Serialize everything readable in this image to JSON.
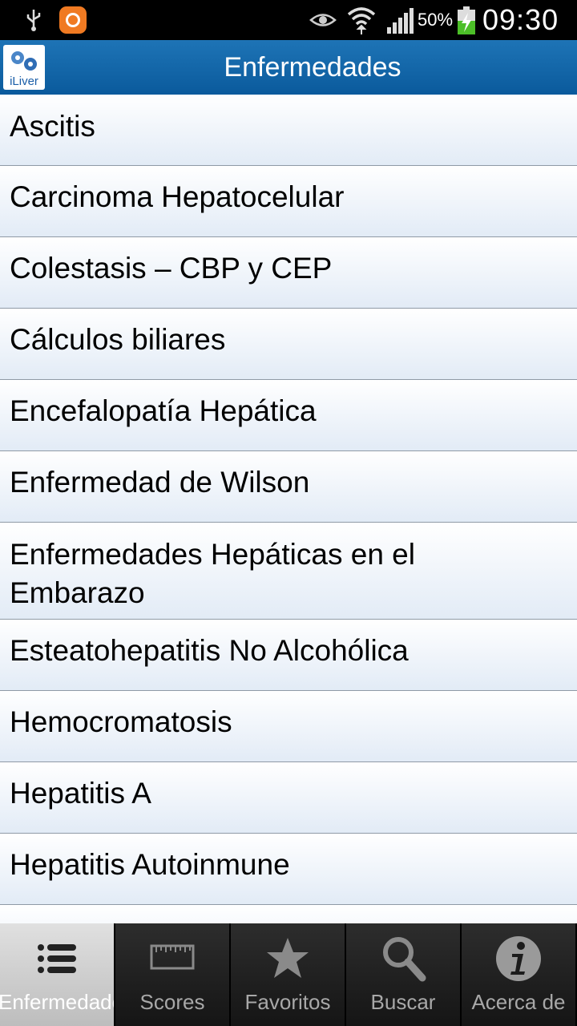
{
  "status_bar": {
    "icons": [
      "usb-icon",
      "app-notification-icon",
      "eye-icon",
      "wifi-icon",
      "signal-icon",
      "battery-charging-icon"
    ],
    "battery_text": "50%",
    "time": "09:30"
  },
  "app_bar": {
    "logo_text": "iLiver",
    "title": "Enfermedades"
  },
  "list": {
    "items": [
      {
        "label": "Ascitis"
      },
      {
        "label": "Carcinoma Hepatocelular"
      },
      {
        "label": "Colestasis – CBP y CEP"
      },
      {
        "label": "Cálculos biliares"
      },
      {
        "label": "Encefalopatía Hepática"
      },
      {
        "label": "Enfermedad de Wilson"
      },
      {
        "label": "Enfermedades Hepáticas en el Embarazo"
      },
      {
        "label": "Esteatohepatitis No Alcohólica"
      },
      {
        "label": "Hemocromatosis"
      },
      {
        "label": "Hepatitis A"
      },
      {
        "label": "Hepatitis Autoinmune"
      },
      {
        "label": ""
      }
    ]
  },
  "tab_bar": {
    "tabs": [
      {
        "label": "Enfermedades",
        "icon": "list-icon",
        "active": true
      },
      {
        "label": "Scores",
        "icon": "ruler-icon",
        "active": false
      },
      {
        "label": "Favoritos",
        "icon": "star-icon",
        "active": false
      },
      {
        "label": "Buscar",
        "icon": "magnifier-icon",
        "active": false
      },
      {
        "label": "Acerca de",
        "icon": "info-icon",
        "active": false
      }
    ]
  }
}
